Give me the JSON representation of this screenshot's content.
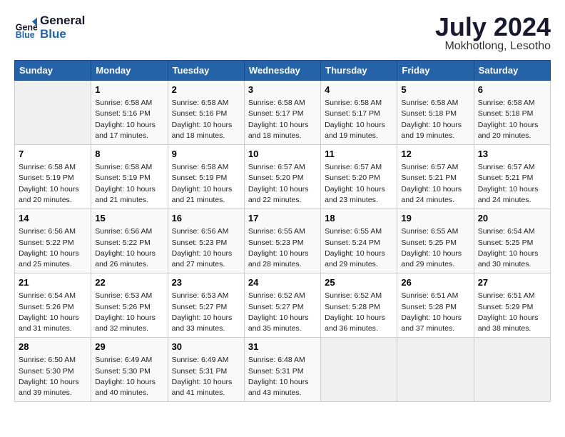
{
  "logo": {
    "line1": "General",
    "line2": "Blue"
  },
  "title": "July 2024",
  "location": "Mokhotlong, Lesotho",
  "weekdays": [
    "Sunday",
    "Monday",
    "Tuesday",
    "Wednesday",
    "Thursday",
    "Friday",
    "Saturday"
  ],
  "weeks": [
    [
      {
        "day": "",
        "info": ""
      },
      {
        "day": "1",
        "info": "Sunrise: 6:58 AM\nSunset: 5:16 PM\nDaylight: 10 hours\nand 17 minutes."
      },
      {
        "day": "2",
        "info": "Sunrise: 6:58 AM\nSunset: 5:16 PM\nDaylight: 10 hours\nand 18 minutes."
      },
      {
        "day": "3",
        "info": "Sunrise: 6:58 AM\nSunset: 5:17 PM\nDaylight: 10 hours\nand 18 minutes."
      },
      {
        "day": "4",
        "info": "Sunrise: 6:58 AM\nSunset: 5:17 PM\nDaylight: 10 hours\nand 19 minutes."
      },
      {
        "day": "5",
        "info": "Sunrise: 6:58 AM\nSunset: 5:18 PM\nDaylight: 10 hours\nand 19 minutes."
      },
      {
        "day": "6",
        "info": "Sunrise: 6:58 AM\nSunset: 5:18 PM\nDaylight: 10 hours\nand 20 minutes."
      }
    ],
    [
      {
        "day": "7",
        "info": "Sunrise: 6:58 AM\nSunset: 5:19 PM\nDaylight: 10 hours\nand 20 minutes."
      },
      {
        "day": "8",
        "info": "Sunrise: 6:58 AM\nSunset: 5:19 PM\nDaylight: 10 hours\nand 21 minutes."
      },
      {
        "day": "9",
        "info": "Sunrise: 6:58 AM\nSunset: 5:19 PM\nDaylight: 10 hours\nand 21 minutes."
      },
      {
        "day": "10",
        "info": "Sunrise: 6:57 AM\nSunset: 5:20 PM\nDaylight: 10 hours\nand 22 minutes."
      },
      {
        "day": "11",
        "info": "Sunrise: 6:57 AM\nSunset: 5:20 PM\nDaylight: 10 hours\nand 23 minutes."
      },
      {
        "day": "12",
        "info": "Sunrise: 6:57 AM\nSunset: 5:21 PM\nDaylight: 10 hours\nand 24 minutes."
      },
      {
        "day": "13",
        "info": "Sunrise: 6:57 AM\nSunset: 5:21 PM\nDaylight: 10 hours\nand 24 minutes."
      }
    ],
    [
      {
        "day": "14",
        "info": "Sunrise: 6:56 AM\nSunset: 5:22 PM\nDaylight: 10 hours\nand 25 minutes."
      },
      {
        "day": "15",
        "info": "Sunrise: 6:56 AM\nSunset: 5:22 PM\nDaylight: 10 hours\nand 26 minutes."
      },
      {
        "day": "16",
        "info": "Sunrise: 6:56 AM\nSunset: 5:23 PM\nDaylight: 10 hours\nand 27 minutes."
      },
      {
        "day": "17",
        "info": "Sunrise: 6:55 AM\nSunset: 5:23 PM\nDaylight: 10 hours\nand 28 minutes."
      },
      {
        "day": "18",
        "info": "Sunrise: 6:55 AM\nSunset: 5:24 PM\nDaylight: 10 hours\nand 29 minutes."
      },
      {
        "day": "19",
        "info": "Sunrise: 6:55 AM\nSunset: 5:25 PM\nDaylight: 10 hours\nand 29 minutes."
      },
      {
        "day": "20",
        "info": "Sunrise: 6:54 AM\nSunset: 5:25 PM\nDaylight: 10 hours\nand 30 minutes."
      }
    ],
    [
      {
        "day": "21",
        "info": "Sunrise: 6:54 AM\nSunset: 5:26 PM\nDaylight: 10 hours\nand 31 minutes."
      },
      {
        "day": "22",
        "info": "Sunrise: 6:53 AM\nSunset: 5:26 PM\nDaylight: 10 hours\nand 32 minutes."
      },
      {
        "day": "23",
        "info": "Sunrise: 6:53 AM\nSunset: 5:27 PM\nDaylight: 10 hours\nand 33 minutes."
      },
      {
        "day": "24",
        "info": "Sunrise: 6:52 AM\nSunset: 5:27 PM\nDaylight: 10 hours\nand 35 minutes."
      },
      {
        "day": "25",
        "info": "Sunrise: 6:52 AM\nSunset: 5:28 PM\nDaylight: 10 hours\nand 36 minutes."
      },
      {
        "day": "26",
        "info": "Sunrise: 6:51 AM\nSunset: 5:28 PM\nDaylight: 10 hours\nand 37 minutes."
      },
      {
        "day": "27",
        "info": "Sunrise: 6:51 AM\nSunset: 5:29 PM\nDaylight: 10 hours\nand 38 minutes."
      }
    ],
    [
      {
        "day": "28",
        "info": "Sunrise: 6:50 AM\nSunset: 5:30 PM\nDaylight: 10 hours\nand 39 minutes."
      },
      {
        "day": "29",
        "info": "Sunrise: 6:49 AM\nSunset: 5:30 PM\nDaylight: 10 hours\nand 40 minutes."
      },
      {
        "day": "30",
        "info": "Sunrise: 6:49 AM\nSunset: 5:31 PM\nDaylight: 10 hours\nand 41 minutes."
      },
      {
        "day": "31",
        "info": "Sunrise: 6:48 AM\nSunset: 5:31 PM\nDaylight: 10 hours\nand 43 minutes."
      },
      {
        "day": "",
        "info": ""
      },
      {
        "day": "",
        "info": ""
      },
      {
        "day": "",
        "info": ""
      }
    ]
  ]
}
